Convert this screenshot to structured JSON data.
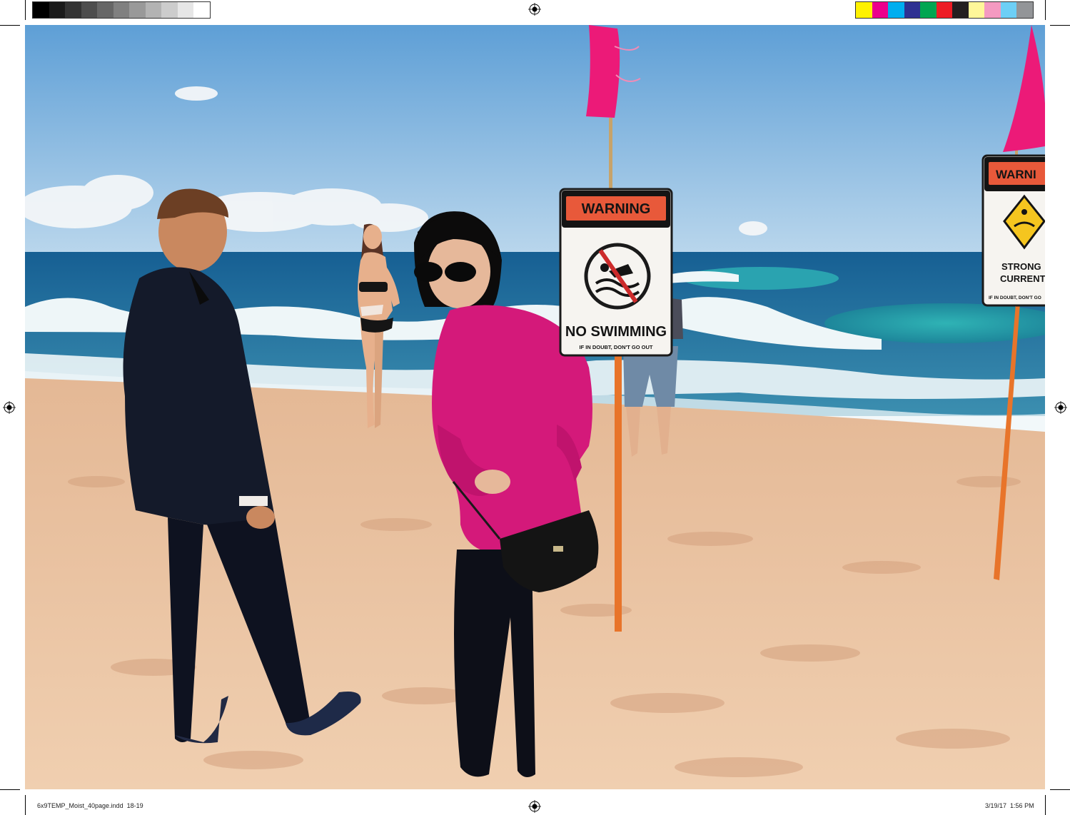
{
  "print_marks": {
    "gray_swatches": [
      "#000000",
      "#1a1a1a",
      "#333333",
      "#4d4d4d",
      "#666666",
      "#808080",
      "#999999",
      "#b3b3b3",
      "#cccccc",
      "#e6e6e6",
      "#ffffff"
    ],
    "color_swatches": [
      "#fff200",
      "#ec008c",
      "#00aeef",
      "#2e3192",
      "#00a651",
      "#ed1c24",
      "#231f20",
      "#fff799",
      "#f49ac1",
      "#6dcff6",
      "#939598"
    ]
  },
  "slug": {
    "file": "6x9TEMP_Moist_40page.indd",
    "pages": "18-19",
    "date": "3/19/17",
    "time": "1:56 PM"
  },
  "signs": {
    "main": {
      "header": "WARNING",
      "title": "NO SWIMMING",
      "subtitle": "IF IN DOUBT, DON'T GO OUT"
    },
    "right": {
      "header": "WARNI",
      "line1": "STRONG",
      "line2": "CURRENT",
      "subtitle": "IF IN DOUBT, DON'T GO"
    }
  },
  "colors": {
    "flag": "#ec1a78",
    "sign_header": "#e8593a",
    "pole": "#e8742a",
    "sand": "#e9bf9c",
    "ocean": "#1a6e9c",
    "sky": "#79b3e0",
    "cardigan": "#d4197a"
  }
}
